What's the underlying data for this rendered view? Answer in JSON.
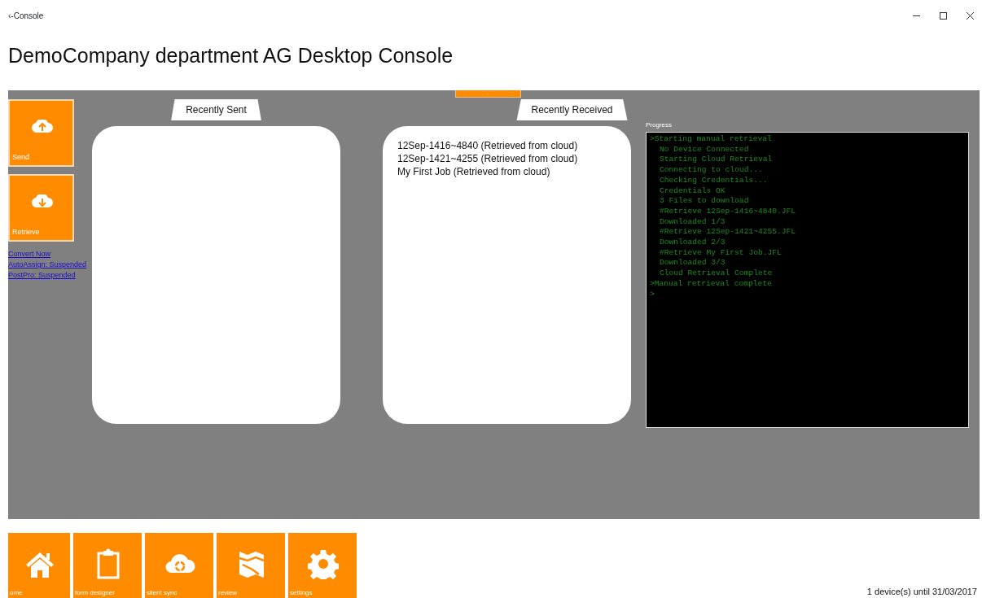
{
  "window": {
    "title": "‹-Console"
  },
  "heading": "DemoCompany department AG Desktop Console",
  "side_tiles": [
    {
      "label": "Send",
      "kind": "upload"
    },
    {
      "label": "Retrieve",
      "kind": "download"
    }
  ],
  "side_links": [
    "Convert Now",
    "AutoAssign: Suspended",
    "PostPro: Suspended"
  ],
  "top_tab": {
    "label": "-"
  },
  "recently_sent": {
    "title": "Recently Sent"
  },
  "recently_received": {
    "title": "Recently Received",
    "items": [
      "12Sep-1416~4840 (Retrieved from cloud)",
      "12Sep-1421~4255 (Retrieved from cloud)",
      "My First Job (Retrieved from cloud)"
    ]
  },
  "progress": {
    "label": "Progress",
    "lines": [
      {
        "text": ">Starting manual retrieval",
        "indent": false
      },
      {
        "text": "No Device Connected",
        "indent": true
      },
      {
        "text": "Starting Cloud Retrieval",
        "indent": true
      },
      {
        "text": "Connecting to cloud...",
        "indent": true
      },
      {
        "text": "Checking Credentials...",
        "indent": true
      },
      {
        "text": "Credentials OK",
        "indent": true
      },
      {
        "text": "3 Files to download",
        "indent": true
      },
      {
        "text": "#Retrieve 12Sep-1416~4840.JFL",
        "indent": true
      },
      {
        "text": "Downloaded 1/3",
        "indent": true
      },
      {
        "text": "#Retrieve 12Sep-1421~4255.JFL",
        "indent": true
      },
      {
        "text": "Downloaded 2/3",
        "indent": true
      },
      {
        "text": "#Retrieve My First Job.JFL",
        "indent": true
      },
      {
        "text": "Downloaded 3/3",
        "indent": true
      },
      {
        "text": "Cloud Retrieval Complete",
        "indent": true
      },
      {
        "text": ">Manual retrieval complete",
        "indent": false
      },
      {
        "text": ">",
        "indent": false
      }
    ]
  },
  "nav_tiles": [
    {
      "label": "ome",
      "kind": "home"
    },
    {
      "label": "form designer",
      "kind": "clipboard"
    },
    {
      "label": "silent sync",
      "kind": "sync"
    },
    {
      "label": "review",
      "kind": "map"
    },
    {
      "label": "settings",
      "kind": "gear"
    }
  ],
  "status": "1 device(s) until 31/03/2017"
}
